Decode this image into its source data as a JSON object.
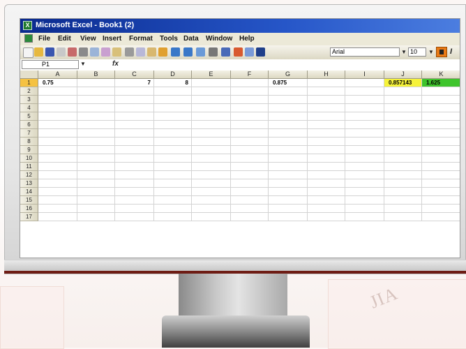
{
  "window": {
    "title": "Microsoft Excel - Book1 (2)",
    "app_icon_glyph": "X"
  },
  "menu": [
    "File",
    "Edit",
    "View",
    "Insert",
    "Format",
    "Tools",
    "Data",
    "Window",
    "Help"
  ],
  "toolbar": {
    "font": "Arial",
    "size": "10",
    "bold_glyph": "B",
    "italic_glyph": "I"
  },
  "formula_bar": {
    "cell_ref": "P1",
    "fx_label": "fx",
    "content": ""
  },
  "sheet": {
    "columns": [
      "A",
      "B",
      "C",
      "D",
      "E",
      "F",
      "G",
      "H",
      "I",
      "J",
      "K"
    ],
    "rows": [
      "1",
      "2",
      "3",
      "4",
      "5",
      "6",
      "7",
      "8",
      "9",
      "10",
      "11",
      "12",
      "13",
      "14",
      "15",
      "16",
      "17"
    ],
    "row1": {
      "A": "0.75",
      "C": "7",
      "D": "8",
      "G": "0.875",
      "J": "0.857143",
      "K": "1.625"
    }
  },
  "colors": {
    "highlight_yellow": "#f6f33a",
    "highlight_green": "#3ec42c",
    "title_bar": "#0a2a8e",
    "accent_red": "#6e1c14"
  },
  "watermark": "JIA"
}
